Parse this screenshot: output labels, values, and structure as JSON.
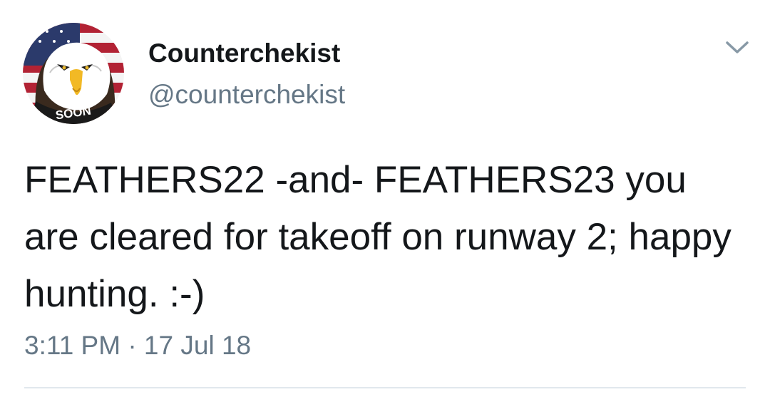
{
  "tweet": {
    "avatar": {
      "icon": "bald-eagle-flag-avatar",
      "badge_text": "SOON"
    },
    "author": {
      "display_name": "Counterchekist",
      "handle": "@counterchekist"
    },
    "menu_icon": "chevron-down-icon",
    "text": "FEATHERS22 -and- FEATHERS23 you are cleared for takeoff on runway 2; happy hunting. :-)",
    "timestamp": "3:11 PM · 17 Jul 18"
  },
  "colors": {
    "text_primary": "#14171a",
    "text_secondary": "#657786",
    "divider": "#e1e8ed",
    "chevron": "#8899a6"
  }
}
